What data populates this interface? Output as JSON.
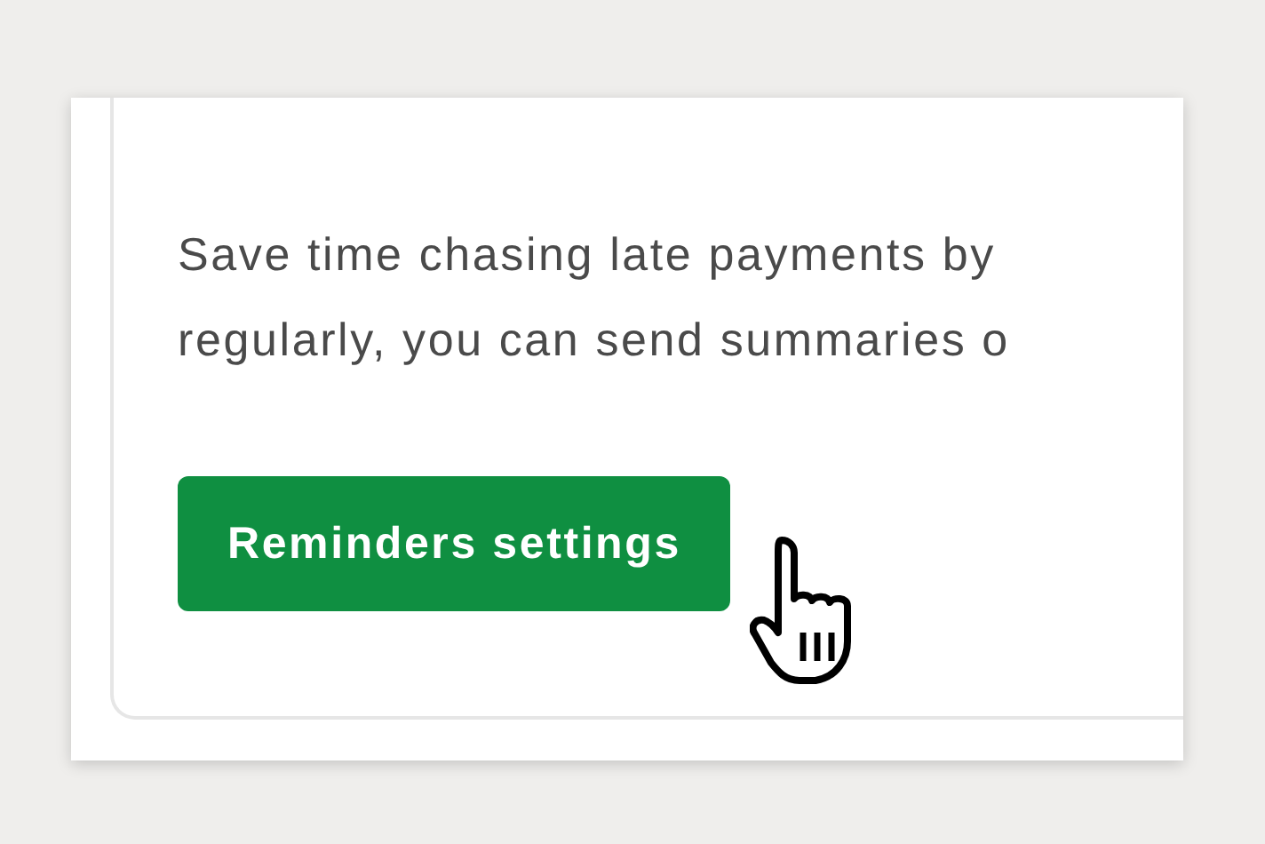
{
  "card": {
    "description_lines": [
      "Save time chasing late payments by",
      "regularly, you can send summaries o"
    ],
    "button": {
      "label": "Reminders settings",
      "hovered": true
    }
  }
}
